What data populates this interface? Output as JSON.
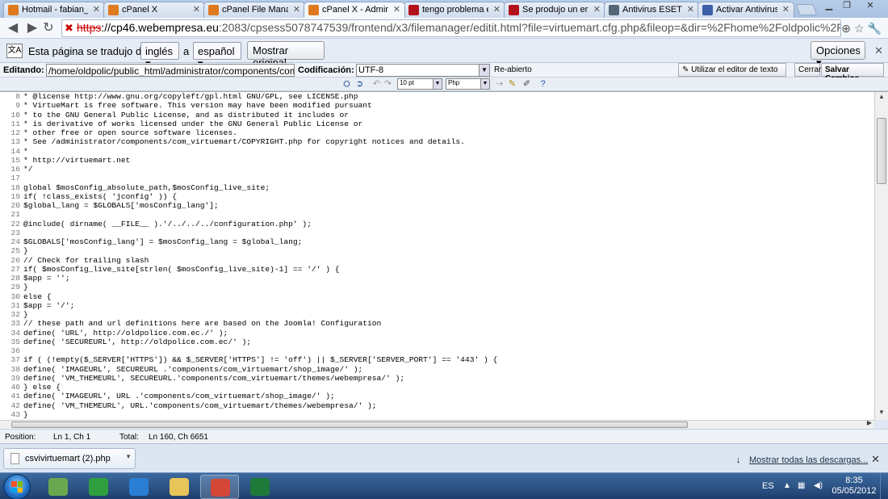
{
  "tabs": [
    {
      "title": "Hotmail - fabian_15",
      "favicon_color": "#e07a1f",
      "active": false
    },
    {
      "title": "cPanel X",
      "favicon_color": "#e07a1f",
      "active": false
    },
    {
      "title": "cPanel File Manage",
      "favicon_color": "#e07a1f",
      "active": false
    },
    {
      "title": "cPanel X - Administ",
      "favicon_color": "#e07a1f",
      "active": true
    },
    {
      "title": "tengo problema en",
      "favicon_color": "#b3121a",
      "active": false
    },
    {
      "title": "Se produjo un error",
      "favicon_color": "#b3121a",
      "active": false
    },
    {
      "title": "Antivirus ESET ECU",
      "favicon_color": "#556677",
      "active": false
    },
    {
      "title": "Activar Antivirus - F",
      "favicon_color": "#3b5fa8",
      "active": false
    }
  ],
  "address": {
    "scheme": "https",
    "host": "://cp46.webempresa.eu",
    "rest": ":2083/cpsess5078747539/frontend/x3/filemanager/editit.html?file=virtuemart.cfg.php&fileop=&dir=%2Fhome%2Foldpolic%2Fpublic_html%2Fadmi"
  },
  "translate": {
    "prefix": "Esta página se tradujo de",
    "from_lang": "inglés",
    "to_word": "a",
    "to_lang": "español",
    "show_original": "Mostrar original",
    "options": "Opciones"
  },
  "editor": {
    "editing_label": "Editando:",
    "path": "/home/oldpolic/public_html/administrator/components/com_virtuemart/",
    "encoding_label": "Codificación:",
    "encoding": "UTF-8",
    "reopen": "Re-abierto",
    "use_text_editor": "Utilizar el editor de texto",
    "close": "Cerrar",
    "save": "Salvar Cambios",
    "font_size": "10 pt",
    "language": "Php"
  },
  "code_lines": [
    {
      "n": "8",
      "text": "* @license http://www.gnu.org/copyleft/gpl.html GNU/GPL, see LICENSE.php"
    },
    {
      "n": "9",
      "text": "* VirtueMart is free software. This version may have been modified pursuant"
    },
    {
      "n": "10",
      "text": "* to the GNU General Public License, and as distributed it includes or"
    },
    {
      "n": "11",
      "text": "* is derivative of works licensed under the GNU General Public License or"
    },
    {
      "n": "12",
      "text": "* other free or open source software licenses."
    },
    {
      "n": "13",
      "text": "* See /administrator/components/com_virtuemart/COPYRIGHT.php for copyright notices and details."
    },
    {
      "n": "14",
      "text": "*"
    },
    {
      "n": "15",
      "text": "* http://virtuemart.net"
    },
    {
      "n": "16",
      "text": "*/"
    },
    {
      "n": "17",
      "text": ""
    },
    {
      "n": "18",
      "text": "global $mosConfig_absolute_path,$mosConfig_live_site;"
    },
    {
      "n": "19",
      "text": "if( !class_exists( 'jconfig' )) {"
    },
    {
      "n": "20",
      "text": "$global_lang = $GLOBALS['mosConfig_lang'];"
    },
    {
      "n": "21",
      "text": ""
    },
    {
      "n": "22",
      "text": "@include( dirname( __FILE__ ).'/../../../configuration.php' );"
    },
    {
      "n": "23",
      "text": ""
    },
    {
      "n": "24",
      "text": "$GLOBALS['mosConfig_lang'] = $mosConfig_lang = $global_lang;"
    },
    {
      "n": "25",
      "text": "}"
    },
    {
      "n": "26",
      "text": "// Check for trailing slash"
    },
    {
      "n": "27",
      "text": "if( $mosConfig_live_site[strlen( $mosConfig_live_site)-1] == '/' ) {"
    },
    {
      "n": "28",
      "text": "$app = '';"
    },
    {
      "n": "29",
      "text": "}"
    },
    {
      "n": "30",
      "text": "else {"
    },
    {
      "n": "31",
      "text": "$app = '/';"
    },
    {
      "n": "32",
      "text": "}"
    },
    {
      "n": "33",
      "text": "// these path and url definitions here are based on the Joomla! Configuration"
    },
    {
      "n": "34",
      "text": "define( 'URL', http://oldpolice.com.ec./' );"
    },
    {
      "n": "35",
      "text": "define( 'SECUREURL', http://oldpolice.com.ec/' );"
    },
    {
      "n": "36",
      "text": ""
    },
    {
      "n": "37",
      "text": "if ( (!empty($_SERVER['HTTPS']) && $_SERVER['HTTPS'] != 'off') || $_SERVER['SERVER_PORT'] == '443' ) {"
    },
    {
      "n": "38",
      "text": "define( 'IMAGEURL', SECUREURL .'components/com_virtuemart/shop_image/' );"
    },
    {
      "n": "39",
      "text": "define( 'VM_THEMEURL', SECUREURL.'components/com_virtuemart/themes/webempresa/' );"
    },
    {
      "n": "40",
      "text": "} else {"
    },
    {
      "n": "41",
      "text": "define( 'IMAGEURL', URL .'components/com_virtuemart/shop_image/' );"
    },
    {
      "n": "42",
      "text": "define( 'VM_THEMEURL', URL.'components/com_virtuemart/themes/webempresa/' );"
    },
    {
      "n": "43",
      "text": "}"
    }
  ],
  "status": {
    "position_label": "Position:",
    "position": "Ln 1, Ch 1",
    "total_label": "Total:",
    "total": "Ln 160, Ch 6651"
  },
  "downloads": {
    "file": "csvivirtuemart (2).php",
    "show_all": "Mostrar todas las descargas..."
  },
  "taskbar": {
    "apps": [
      {
        "name": "control-panel",
        "color": "#6aa84f",
        "active": false
      },
      {
        "name": "app-green-circle",
        "color": "#2e9e3e",
        "active": false
      },
      {
        "name": "internet-explorer",
        "color": "#2a7fd4",
        "active": false
      },
      {
        "name": "file-explorer",
        "color": "#e8c55a",
        "active": false
      },
      {
        "name": "chrome",
        "color": "#d44638",
        "active": true
      },
      {
        "name": "excel",
        "color": "#1f7a3a",
        "active": false
      }
    ],
    "language": "ES",
    "time": "8:35",
    "date": "05/05/2012"
  }
}
